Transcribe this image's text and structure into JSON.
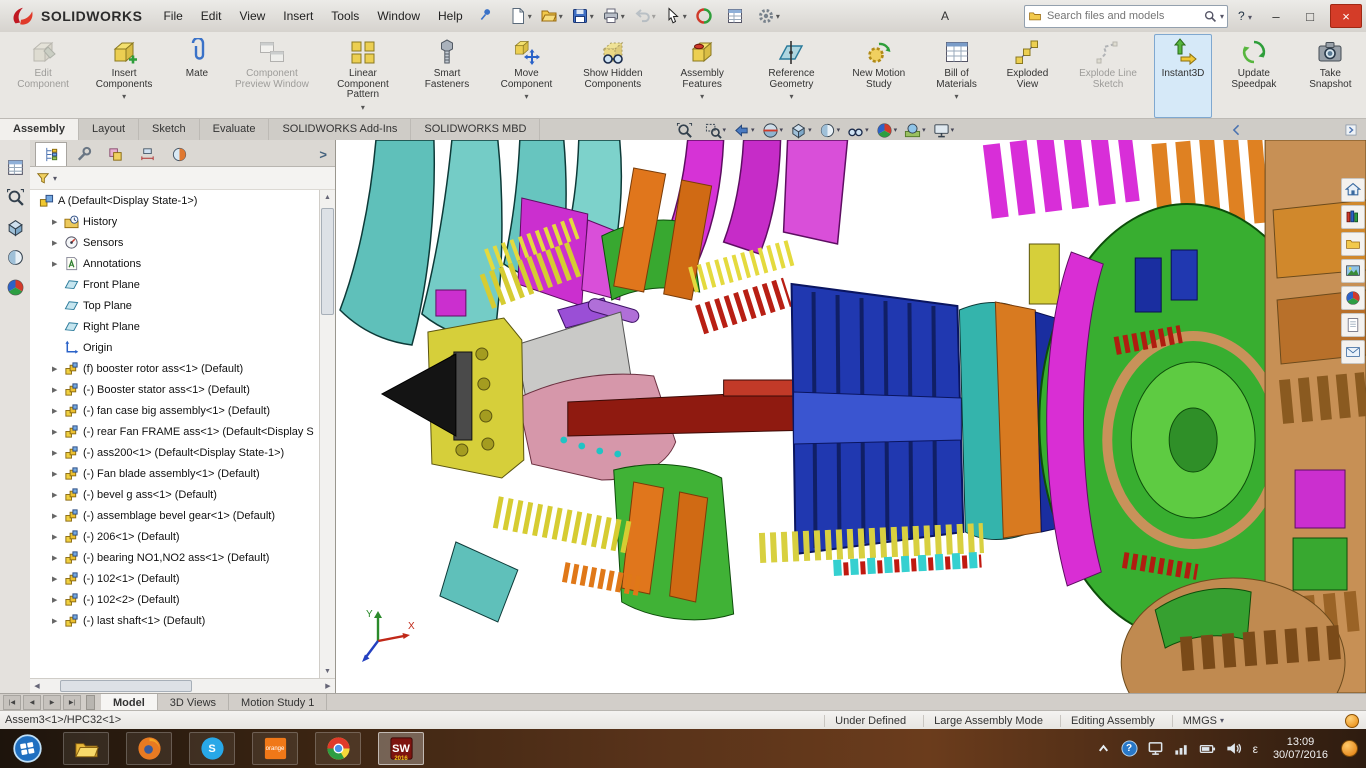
{
  "titlebar": {
    "brand": "SOLIDWORKS",
    "document_title": "A",
    "menus": [
      "File",
      "Edit",
      "View",
      "Insert",
      "Tools",
      "Window",
      "Help"
    ],
    "quick_tools": [
      {
        "name": "new-document-icon",
        "icon": "newdoc",
        "dropdown": true
      },
      {
        "name": "open-icon",
        "icon": "open",
        "dropdown": true
      },
      {
        "name": "save-icon",
        "icon": "save",
        "dropdown": true
      },
      {
        "name": "print-icon",
        "icon": "print",
        "dropdown": true
      },
      {
        "name": "undo-icon",
        "icon": "undo",
        "dropdown": true,
        "state": "disabled"
      },
      {
        "name": "select-icon",
        "icon": "select",
        "dropdown": true
      },
      {
        "name": "rebuild-icon",
        "icon": "rebuild",
        "dropdown": false
      },
      {
        "name": "file-properties-icon",
        "icon": "props",
        "dropdown": false
      },
      {
        "name": "options-icon",
        "icon": "options",
        "dropdown": true
      }
    ],
    "search_placeholder": "Search files and models",
    "help_label": "?",
    "window_minimize": "–",
    "window_maximize": "□",
    "window_close": "×"
  },
  "ribbon": {
    "buttons": [
      {
        "label": "Edit Component",
        "icon": "editcomp",
        "state": "disabled"
      },
      {
        "label": "Insert Components",
        "icon": "insert",
        "dropdown": true
      },
      {
        "label": "Mate",
        "icon": "mate"
      },
      {
        "label": "Component Preview Window",
        "icon": "preview",
        "state": "disabled"
      },
      {
        "label": "Linear Component Pattern",
        "icon": "pattern",
        "dropdown": true
      },
      {
        "label": "Smart Fasteners",
        "icon": "fast"
      },
      {
        "label": "Move Component",
        "icon": "movec",
        "dropdown": true
      },
      {
        "label": "Show Hidden Components",
        "icon": "hidden"
      },
      {
        "label": "Assembly Features",
        "icon": "asmfeat",
        "dropdown": true
      },
      {
        "label": "Reference Geometry",
        "icon": "refgeo",
        "dropdown": true
      },
      {
        "label": "New Motion Study",
        "icon": "motion"
      },
      {
        "label": "Bill of Materials",
        "icon": "bom",
        "dropdown": true
      },
      {
        "label": "Exploded View",
        "icon": "explode"
      },
      {
        "label": "Explode Line Sketch",
        "icon": "explline",
        "state": "disabled"
      },
      {
        "label": "Instant3D",
        "icon": "instant3d",
        "state": "active"
      },
      {
        "label": "Update Speedpak",
        "icon": "speedpak"
      },
      {
        "label": "Take Snapshot",
        "icon": "snapshot"
      }
    ]
  },
  "command_tabs": [
    {
      "label": "Assembly",
      "state": "active"
    },
    {
      "label": "Layout"
    },
    {
      "label": "Sketch"
    },
    {
      "label": "Evaluate"
    },
    {
      "label": "SOLIDWORKS Add-Ins"
    },
    {
      "label": "SOLIDWORKS MBD"
    }
  ],
  "headsup_tools": [
    {
      "name": "zoom-fit-icon",
      "icon": "hu-zoomfit"
    },
    {
      "name": "zoom-area-icon",
      "icon": "hu-zoomarea",
      "dropdown": true
    },
    {
      "name": "previous-view-icon",
      "icon": "hu-prev",
      "dropdown": true
    },
    {
      "name": "section-view-icon",
      "icon": "hu-section",
      "dropdown": true
    },
    {
      "name": "view-orientation-icon",
      "icon": "hu-orient",
      "dropdown": true
    },
    {
      "name": "display-style-icon",
      "icon": "hu-display",
      "dropdown": true
    },
    {
      "name": "hide-show-items-icon",
      "icon": "hu-hide",
      "dropdown": true
    },
    {
      "name": "edit-appearance-icon",
      "icon": "hu-appearance",
      "dropdown": true
    },
    {
      "name": "apply-scene-icon",
      "icon": "hu-scene",
      "dropdown": true
    },
    {
      "name": "view-settings-icon",
      "icon": "hu-settings",
      "dropdown": true
    }
  ],
  "dock_tools": [
    {
      "name": "dock-document-icon",
      "icon": "props"
    },
    {
      "name": "dock-zoom-icon",
      "icon": "hu-zoomfit"
    },
    {
      "name": "dock-cube-icon",
      "icon": "hu-orient"
    },
    {
      "name": "dock-display-icon",
      "icon": "hu-display"
    },
    {
      "name": "dock-appearance-icon",
      "icon": "hu-appearance"
    }
  ],
  "panel": {
    "tabs": [
      {
        "name": "featuremanager-tab-icon",
        "icon": "pt-tree",
        "state": "active"
      },
      {
        "name": "propertymanager-tab-icon",
        "icon": "pt-prop"
      },
      {
        "name": "configurationmanager-tab-icon",
        "icon": "pt-config"
      },
      {
        "name": "dimxpertmanager-tab-icon",
        "icon": "pt-dimx"
      },
      {
        "name": "displaymanager-tab-icon",
        "icon": "pt-disp"
      }
    ],
    "flyout_chevron": ">"
  },
  "feature_tree": {
    "root": "A (Default<Display State-1>)",
    "items": [
      {
        "label": "History",
        "icon": "t-hist",
        "arrow": true
      },
      {
        "label": "Sensors",
        "icon": "t-sens",
        "arrow": true
      },
      {
        "label": "Annotations",
        "icon": "t-ann",
        "arrow": true
      },
      {
        "label": "Front Plane",
        "icon": "t-plane",
        "arrow": false
      },
      {
        "label": "Top Plane",
        "icon": "t-plane",
        "arrow": false
      },
      {
        "label": "Right Plane",
        "icon": "t-plane",
        "arrow": false
      },
      {
        "label": "Origin",
        "icon": "t-origin",
        "arrow": false
      },
      {
        "label": "(f) booster rotor ass<1> (Default)",
        "icon": "t-asm",
        "arrow": true
      },
      {
        "label": "(-) Booster stator ass<1> (Default)",
        "icon": "t-asm",
        "arrow": true
      },
      {
        "label": "(-) fan case  big assembly<1> (Default)",
        "icon": "t-asm",
        "arrow": true
      },
      {
        "label": "(-) rear Fan FRAME ass<1> (Default<Display S",
        "icon": "t-asm",
        "arrow": true
      },
      {
        "label": "(-) ass200<1> (Default<Display State-1>)",
        "icon": "t-asm",
        "arrow": true
      },
      {
        "label": "(-) Fan blade assembly<1> (Default)",
        "icon": "t-asm",
        "arrow": true
      },
      {
        "label": "(-) bevel g ass<1> (Default)",
        "icon": "t-asm",
        "arrow": true
      },
      {
        "label": "(-) assemblage bevel gear<1> (Default)",
        "icon": "t-asm",
        "arrow": true
      },
      {
        "label": "(-) 206<1> (Default)",
        "icon": "t-asm",
        "arrow": true
      },
      {
        "label": "(-) bearing NO1,NO2 ass<1> (Default)",
        "icon": "t-asm",
        "arrow": true
      },
      {
        "label": "(-) 102<1> (Default)",
        "icon": "t-asm",
        "arrow": true
      },
      {
        "label": "(-) 102<2> (Default)",
        "icon": "t-asm",
        "arrow": true
      },
      {
        "label": "(-) last shaft<1> (Default)",
        "icon": "t-asm",
        "arrow": true
      }
    ]
  },
  "viewport": {
    "background": "#ffffff",
    "triad_x": "X",
    "triad_y": "Y",
    "palette": {
      "fan_blades": "#5fc0ba",
      "fan_hub": "#d6cf3a",
      "frame_green": "#38a830",
      "struts_orange": "#e0761c",
      "compressor_blue": "#2038b0",
      "shaft_red": "#8f1a10",
      "turbine_case": "#38ae30",
      "turbine_ring_magenta": "#d92ed4",
      "exhaust_tan": "#c79055"
    }
  },
  "task_pane": [
    {
      "name": "solidworks-resources-icon",
      "icon": "tp-home"
    },
    {
      "name": "design-library-icon",
      "icon": "tp-lib"
    },
    {
      "name": "file-explorer-icon",
      "icon": "tp-exp"
    },
    {
      "name": "view-palette-icon",
      "icon": "tp-pal"
    },
    {
      "name": "appearances-scenes-icon",
      "icon": "tp-app"
    },
    {
      "name": "custom-properties-icon",
      "icon": "tp-propsheet"
    },
    {
      "name": "solidworks-forum-icon",
      "icon": "tp-forum"
    }
  ],
  "document_tabs": [
    {
      "label": "Model",
      "state": "active"
    },
    {
      "label": "3D Views"
    },
    {
      "label": "Motion Study 1"
    }
  ],
  "statusbar": {
    "left_text": "Assem3<1>/HPC32<1>",
    "items": [
      {
        "label": "Under Defined"
      },
      {
        "label": "Large Assembly Mode"
      },
      {
        "label": "Editing Assembly"
      },
      {
        "label": "MMGS",
        "dropdown": true
      }
    ]
  },
  "taskbar": {
    "apps": [
      {
        "name": "start-button",
        "icon": "tb-start",
        "state": "start"
      },
      {
        "name": "file-explorer-button",
        "icon": "tb-exp"
      },
      {
        "name": "firefox-button",
        "icon": "tb-ff"
      },
      {
        "name": "skype-button",
        "icon": "tb-skype",
        "badge": "S"
      },
      {
        "name": "orange-app-button",
        "icon": "tb-orange",
        "badge": "orange",
        "badge_size": "tiny"
      },
      {
        "name": "chrome-button",
        "icon": "tb-chrome"
      },
      {
        "name": "solidworks-button",
        "icon": "tb-sw",
        "badge": "SW",
        "badge2": "2016",
        "state": "active"
      }
    ],
    "tray": [
      {
        "name": "hidden-icons-chevron",
        "icon": "tb-chev"
      },
      {
        "name": "help-tray-icon",
        "icon": "tb-help",
        "badge": "?"
      },
      {
        "name": "display-tray-icon",
        "icon": "tb-mon"
      },
      {
        "name": "network-tray-icon",
        "icon": "tb-net"
      },
      {
        "name": "battery-tray-icon",
        "icon": "tb-bat"
      },
      {
        "name": "volume-tray-icon",
        "icon": "tb-vol"
      }
    ],
    "language": "ε",
    "time": "13:09",
    "date": "30/07/2016"
  }
}
